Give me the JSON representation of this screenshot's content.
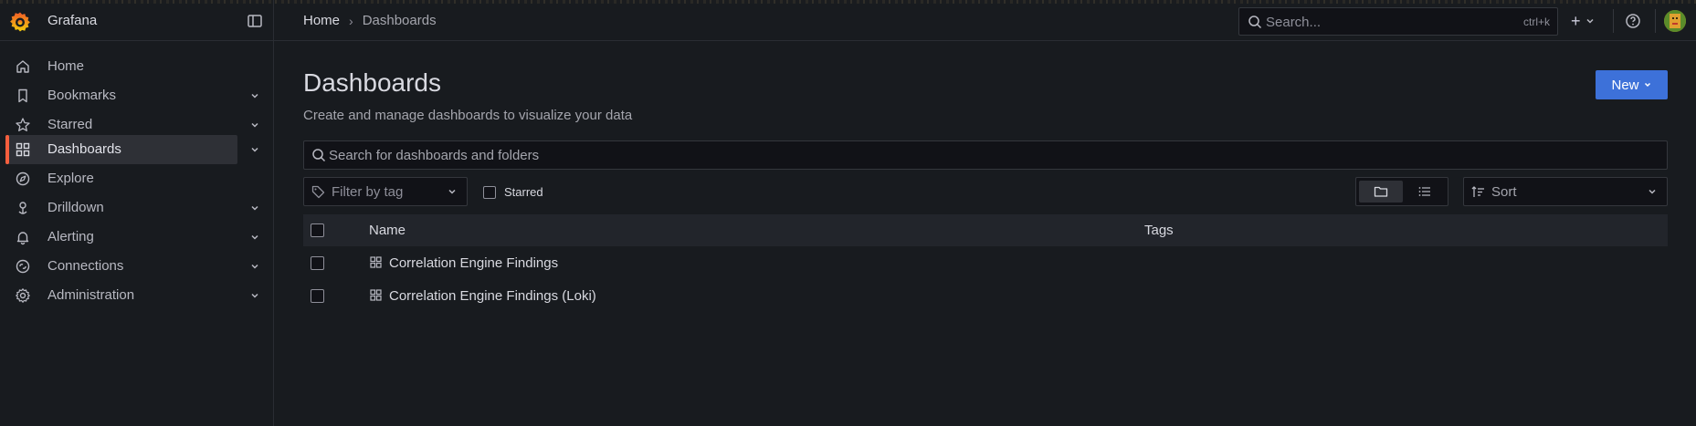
{
  "app": {
    "brand": "Grafana"
  },
  "breadcrumb": {
    "home": "Home",
    "separator": "›",
    "current": "Dashboards"
  },
  "topbar": {
    "search_placeholder": "Search...",
    "search_shortcut": "ctrl+k",
    "add_label": "+"
  },
  "sidebar": {
    "items": [
      {
        "label": "Home",
        "icon": "home-icon",
        "expandable": false,
        "active": false
      },
      {
        "label": "Bookmarks",
        "icon": "bookmark-icon",
        "expandable": true,
        "active": false
      },
      {
        "label": "Starred",
        "icon": "star-icon",
        "expandable": true,
        "active": false
      },
      {
        "label": "Dashboards",
        "icon": "apps-icon",
        "expandable": true,
        "active": true
      },
      {
        "label": "Explore",
        "icon": "compass-icon",
        "expandable": false,
        "active": false
      },
      {
        "label": "Drilldown",
        "icon": "drilldown-icon",
        "expandable": true,
        "active": false
      },
      {
        "label": "Alerting",
        "icon": "bell-icon",
        "expandable": true,
        "active": false
      },
      {
        "label": "Connections",
        "icon": "link-icon",
        "expandable": true,
        "active": false
      },
      {
        "label": "Administration",
        "icon": "cog-icon",
        "expandable": true,
        "active": false
      }
    ]
  },
  "page": {
    "title": "Dashboards",
    "subtitle": "Create and manage dashboards to visualize your data",
    "new_button": "New",
    "search_placeholder": "Search for dashboards and folders",
    "tag_filter_placeholder": "Filter by tag",
    "starred_label": "Starred",
    "sort_placeholder": "Sort",
    "view_mode": "folder"
  },
  "table": {
    "columns": {
      "name": "Name",
      "tags": "Tags"
    },
    "rows": [
      {
        "title": "Correlation Engine Findings",
        "tags": ""
      },
      {
        "title": "Correlation Engine Findings (Loki)",
        "tags": ""
      }
    ]
  },
  "colors": {
    "accent": "#3d71d9",
    "active_indicator": "#f55f3e",
    "background": "#181b1f"
  }
}
